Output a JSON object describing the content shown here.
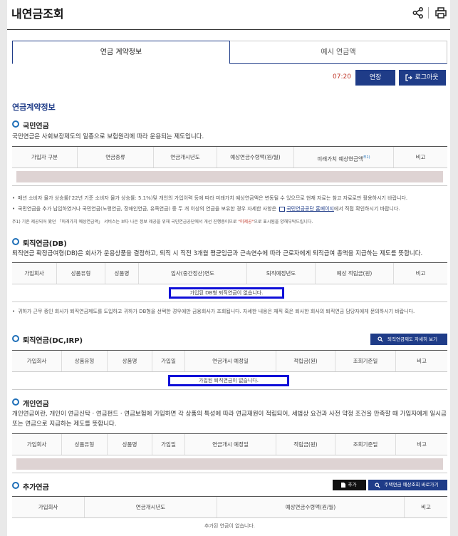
{
  "header": {
    "title": "내연금조회",
    "icons": [
      "share-icon",
      "print-icon"
    ]
  },
  "tabs": [
    {
      "label": "연금 계약정보",
      "active": true
    },
    {
      "label": "예시 연금액",
      "active": false
    }
  ],
  "session": {
    "timer": "07:20",
    "extend_label": "연장",
    "logout_label": "로그아웃"
  },
  "section_title": "연금계약정보",
  "national": {
    "heading": "국민연금",
    "desc": "국민연금은 사회보장제도의 일종으로 보험원리에 따라 운용되는 제도입니다.",
    "columns": [
      "가입자 구분",
      "연금종류",
      "연금개시년도",
      "예상연금수령액(원/월)",
      "미래가치 예상연금액",
      "비고"
    ],
    "future_sup": "주1)",
    "notes": [
      "매년 소비자 물가 상승률('22년 기준 소비자 물가 상승률: 5.1%)및 개인의 가입이력 등에 따라 미래가치 예상연금액은 변동될 수 있으므로 현재 자료는 참고 자료로만 활용하시기 바랍니다.",
      "국민연금을 추가 납입하였거나 국민연금(노령연금, 장애인연금, 유족연금) 중 두 개 이상의 연금을 보유한 경우 자세한 사항은",
      "국민연금공단 홈페이지",
      "에서 직접 확인하시기 바랍니다."
    ],
    "footnote_a": "주1) 기존 제공되어 왔던 「미래가치 예상연금액」 서비스는 보다 나은 정보 제공을 위해 국민연금공단에서 개선 진행중이므로 ",
    "footnote_red": "\"미제공\"",
    "footnote_b": "으로 표시됨을 양해부탁드립니다."
  },
  "db": {
    "heading": "퇴직연금(DB)",
    "desc": "퇴직연금 확정급여형(DB)은 회사가 운용상품을 결정하고, 퇴직 시 직전 3개월 평균임금과 근속연수에 따라 근로자에게 퇴직급여 총액을 지급하는 제도를 뜻합니다.",
    "columns": [
      "가입회사",
      "상품유형",
      "상품명",
      "입사(중간정산)연도",
      "퇴직예정년도",
      "예상 적립금(원)",
      "비고"
    ],
    "empty": "가입된 DB형 퇴직연금이 없습니다.",
    "note": "귀하가 근무 중인 회사가 퇴직연금제도를 도입하고 귀하가 DB형을 선택한 경우에만 금융회사가 조회됩니다. 자세한 내용은 재직 혹은 퇴사한 회사의 퇴직연금 담당자에게 문의하시기 바랍니다."
  },
  "dc": {
    "heading": "퇴직연금(DC,IRP)",
    "detail_button": "퇴직연금제도 자세히 보기",
    "columns": [
      "가입회사",
      "상품유형",
      "상품명",
      "가입일",
      "연금개시 예정일",
      "적립금(원)",
      "조회기준일",
      "비고"
    ],
    "empty": "가입된 퇴직연금이 없습니다."
  },
  "personal": {
    "heading": "개인연금",
    "desc": "개인연금이란, 개인이 연금신탁 · 연금펀드 · 연금보험에 가입하면 각 상품의 특성에 따라 연금재원이 적립되어, 세법상 요건과 사전 약정 조건을 만족할 때 가입자에게 일시금 또는 연금으로 지급하는 제도를 뜻합니다.",
    "columns": [
      "가입회사",
      "상품유형",
      "상품명",
      "가입일",
      "연금개시 예정일",
      "적립금(원)",
      "조회기준일",
      "비고"
    ]
  },
  "additional": {
    "heading": "추가연금",
    "add_button": "추가",
    "housing_button": "주택연금 예상조회 바로가기",
    "columns": [
      "가입회사",
      "연금개시년도",
      "예상연금수령액(원/월)",
      "비고"
    ],
    "empty": "추가된 연금이 없습니다."
  },
  "colors": {
    "navy": "#1f3c88",
    "highlight": "#1010d8",
    "empty_row": "#ded3d3"
  }
}
